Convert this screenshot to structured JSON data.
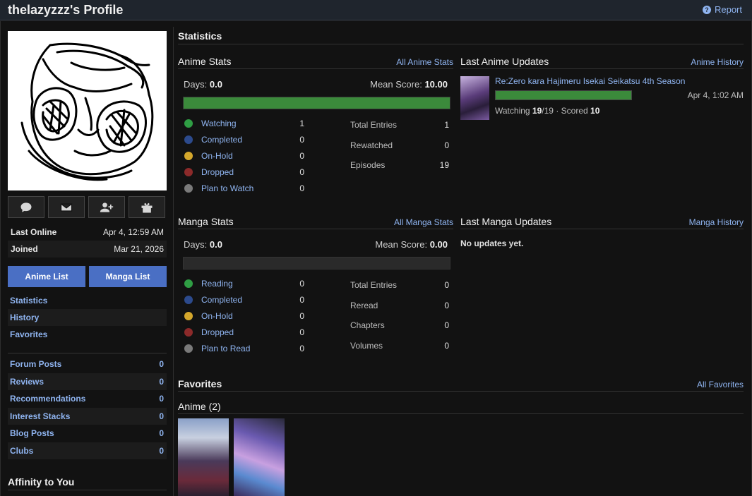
{
  "header": {
    "title": "thelazyzzz's Profile",
    "report_label": "Report"
  },
  "sidebar": {
    "info": [
      {
        "key": "Last Online",
        "value": "Apr 4, 12:59 AM"
      },
      {
        "key": "Joined",
        "value": "Mar 21, 2026"
      }
    ],
    "list_buttons": {
      "anime": "Anime List",
      "manga": "Manga List"
    },
    "nav": [
      "Statistics",
      "History",
      "Favorites"
    ],
    "counts": [
      {
        "label": "Forum Posts",
        "value": "0"
      },
      {
        "label": "Reviews",
        "value": "0"
      },
      {
        "label": "Recommendations",
        "value": "0"
      },
      {
        "label": "Interest Stacks",
        "value": "0"
      },
      {
        "label": "Blog Posts",
        "value": "0"
      },
      {
        "label": "Clubs",
        "value": "0"
      }
    ],
    "affinity_title": "Affinity to You"
  },
  "statistics": {
    "title": "Statistics",
    "anime": {
      "heading": "Anime Stats",
      "link": "All Anime Stats",
      "days_label": "Days:",
      "days": "0.0",
      "mean_label": "Mean Score:",
      "mean": "10.00",
      "progress": 1.0,
      "statuses": [
        {
          "name": "Watching",
          "count": "1",
          "color": "#2f9e44"
        },
        {
          "name": "Completed",
          "count": "0",
          "color": "#2c4a8c"
        },
        {
          "name": "On-Hold",
          "count": "0",
          "color": "#d4a72c"
        },
        {
          "name": "Dropped",
          "count": "0",
          "color": "#8c2a2a"
        },
        {
          "name": "Plan to Watch",
          "count": "0",
          "color": "#7a7a7a"
        }
      ],
      "totals": [
        {
          "label": "Total Entries",
          "value": "1"
        },
        {
          "label": "Rewatched",
          "value": "0"
        },
        {
          "label": "Episodes",
          "value": "19"
        }
      ]
    },
    "manga": {
      "heading": "Manga Stats",
      "link": "All Manga Stats",
      "days_label": "Days:",
      "days": "0.0",
      "mean_label": "Mean Score:",
      "mean": "0.00",
      "progress": 0.0,
      "statuses": [
        {
          "name": "Reading",
          "count": "0",
          "color": "#2f9e44"
        },
        {
          "name": "Completed",
          "count": "0",
          "color": "#2c4a8c"
        },
        {
          "name": "On-Hold",
          "count": "0",
          "color": "#d4a72c"
        },
        {
          "name": "Dropped",
          "count": "0",
          "color": "#8c2a2a"
        },
        {
          "name": "Plan to Read",
          "count": "0",
          "color": "#7a7a7a"
        }
      ],
      "totals": [
        {
          "label": "Total Entries",
          "value": "0"
        },
        {
          "label": "Reread",
          "value": "0"
        },
        {
          "label": "Chapters",
          "value": "0"
        },
        {
          "label": "Volumes",
          "value": "0"
        }
      ]
    }
  },
  "updates": {
    "anime": {
      "heading": "Last Anime Updates",
      "link": "Anime History",
      "item": {
        "title": "Re:Zero kara Hajimeru Isekai Seikatsu 4th Season",
        "progress": 1.0,
        "date": "Apr 4, 1:02 AM",
        "status": "Watching",
        "watched": "19",
        "total": "/19",
        "scored_label": "· Scored",
        "score": "10"
      }
    },
    "manga": {
      "heading": "Last Manga Updates",
      "link": "Manga History",
      "empty": "No updates yet."
    }
  },
  "favorites": {
    "title": "Favorites",
    "link": "All Favorites",
    "anime_heading": "Anime (2)"
  }
}
